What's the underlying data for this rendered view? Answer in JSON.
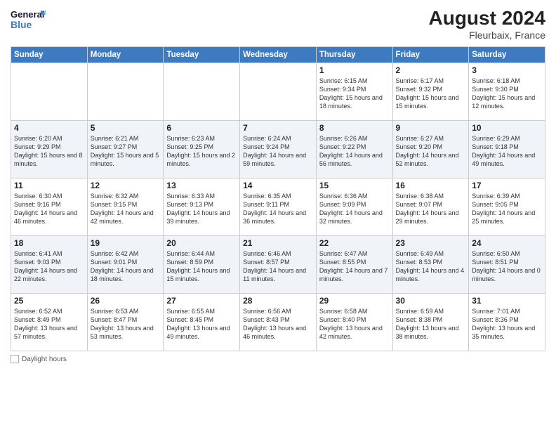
{
  "header": {
    "logo_line1": "General",
    "logo_line2": "Blue",
    "month_year": "August 2024",
    "location": "Fleurbaix, France"
  },
  "weekdays": [
    "Sunday",
    "Monday",
    "Tuesday",
    "Wednesday",
    "Thursday",
    "Friday",
    "Saturday"
  ],
  "weeks": [
    [
      {
        "day": "",
        "info": ""
      },
      {
        "day": "",
        "info": ""
      },
      {
        "day": "",
        "info": ""
      },
      {
        "day": "",
        "info": ""
      },
      {
        "day": "1",
        "info": "Sunrise: 6:15 AM\nSunset: 9:34 PM\nDaylight: 15 hours and 18 minutes."
      },
      {
        "day": "2",
        "info": "Sunrise: 6:17 AM\nSunset: 9:32 PM\nDaylight: 15 hours and 15 minutes."
      },
      {
        "day": "3",
        "info": "Sunrise: 6:18 AM\nSunset: 9:30 PM\nDaylight: 15 hours and 12 minutes."
      }
    ],
    [
      {
        "day": "4",
        "info": "Sunrise: 6:20 AM\nSunset: 9:29 PM\nDaylight: 15 hours and 8 minutes."
      },
      {
        "day": "5",
        "info": "Sunrise: 6:21 AM\nSunset: 9:27 PM\nDaylight: 15 hours and 5 minutes."
      },
      {
        "day": "6",
        "info": "Sunrise: 6:23 AM\nSunset: 9:25 PM\nDaylight: 15 hours and 2 minutes."
      },
      {
        "day": "7",
        "info": "Sunrise: 6:24 AM\nSunset: 9:24 PM\nDaylight: 14 hours and 59 minutes."
      },
      {
        "day": "8",
        "info": "Sunrise: 6:26 AM\nSunset: 9:22 PM\nDaylight: 14 hours and 56 minutes."
      },
      {
        "day": "9",
        "info": "Sunrise: 6:27 AM\nSunset: 9:20 PM\nDaylight: 14 hours and 52 minutes."
      },
      {
        "day": "10",
        "info": "Sunrise: 6:29 AM\nSunset: 9:18 PM\nDaylight: 14 hours and 49 minutes."
      }
    ],
    [
      {
        "day": "11",
        "info": "Sunrise: 6:30 AM\nSunset: 9:16 PM\nDaylight: 14 hours and 46 minutes."
      },
      {
        "day": "12",
        "info": "Sunrise: 6:32 AM\nSunset: 9:15 PM\nDaylight: 14 hours and 42 minutes."
      },
      {
        "day": "13",
        "info": "Sunrise: 6:33 AM\nSunset: 9:13 PM\nDaylight: 14 hours and 39 minutes."
      },
      {
        "day": "14",
        "info": "Sunrise: 6:35 AM\nSunset: 9:11 PM\nDaylight: 14 hours and 36 minutes."
      },
      {
        "day": "15",
        "info": "Sunrise: 6:36 AM\nSunset: 9:09 PM\nDaylight: 14 hours and 32 minutes."
      },
      {
        "day": "16",
        "info": "Sunrise: 6:38 AM\nSunset: 9:07 PM\nDaylight: 14 hours and 29 minutes."
      },
      {
        "day": "17",
        "info": "Sunrise: 6:39 AM\nSunset: 9:05 PM\nDaylight: 14 hours and 25 minutes."
      }
    ],
    [
      {
        "day": "18",
        "info": "Sunrise: 6:41 AM\nSunset: 9:03 PM\nDaylight: 14 hours and 22 minutes."
      },
      {
        "day": "19",
        "info": "Sunrise: 6:42 AM\nSunset: 9:01 PM\nDaylight: 14 hours and 18 minutes."
      },
      {
        "day": "20",
        "info": "Sunrise: 6:44 AM\nSunset: 8:59 PM\nDaylight: 14 hours and 15 minutes."
      },
      {
        "day": "21",
        "info": "Sunrise: 6:46 AM\nSunset: 8:57 PM\nDaylight: 14 hours and 11 minutes."
      },
      {
        "day": "22",
        "info": "Sunrise: 6:47 AM\nSunset: 8:55 PM\nDaylight: 14 hours and 7 minutes."
      },
      {
        "day": "23",
        "info": "Sunrise: 6:49 AM\nSunset: 8:53 PM\nDaylight: 14 hours and 4 minutes."
      },
      {
        "day": "24",
        "info": "Sunrise: 6:50 AM\nSunset: 8:51 PM\nDaylight: 14 hours and 0 minutes."
      }
    ],
    [
      {
        "day": "25",
        "info": "Sunrise: 6:52 AM\nSunset: 8:49 PM\nDaylight: 13 hours and 57 minutes."
      },
      {
        "day": "26",
        "info": "Sunrise: 6:53 AM\nSunset: 8:47 PM\nDaylight: 13 hours and 53 minutes."
      },
      {
        "day": "27",
        "info": "Sunrise: 6:55 AM\nSunset: 8:45 PM\nDaylight: 13 hours and 49 minutes."
      },
      {
        "day": "28",
        "info": "Sunrise: 6:56 AM\nSunset: 8:43 PM\nDaylight: 13 hours and 46 minutes."
      },
      {
        "day": "29",
        "info": "Sunrise: 6:58 AM\nSunset: 8:40 PM\nDaylight: 13 hours and 42 minutes."
      },
      {
        "day": "30",
        "info": "Sunrise: 6:59 AM\nSunset: 8:38 PM\nDaylight: 13 hours and 38 minutes."
      },
      {
        "day": "31",
        "info": "Sunrise: 7:01 AM\nSunset: 8:36 PM\nDaylight: 13 hours and 35 minutes."
      }
    ]
  ],
  "legend": {
    "daylight_label": "Daylight hours"
  }
}
